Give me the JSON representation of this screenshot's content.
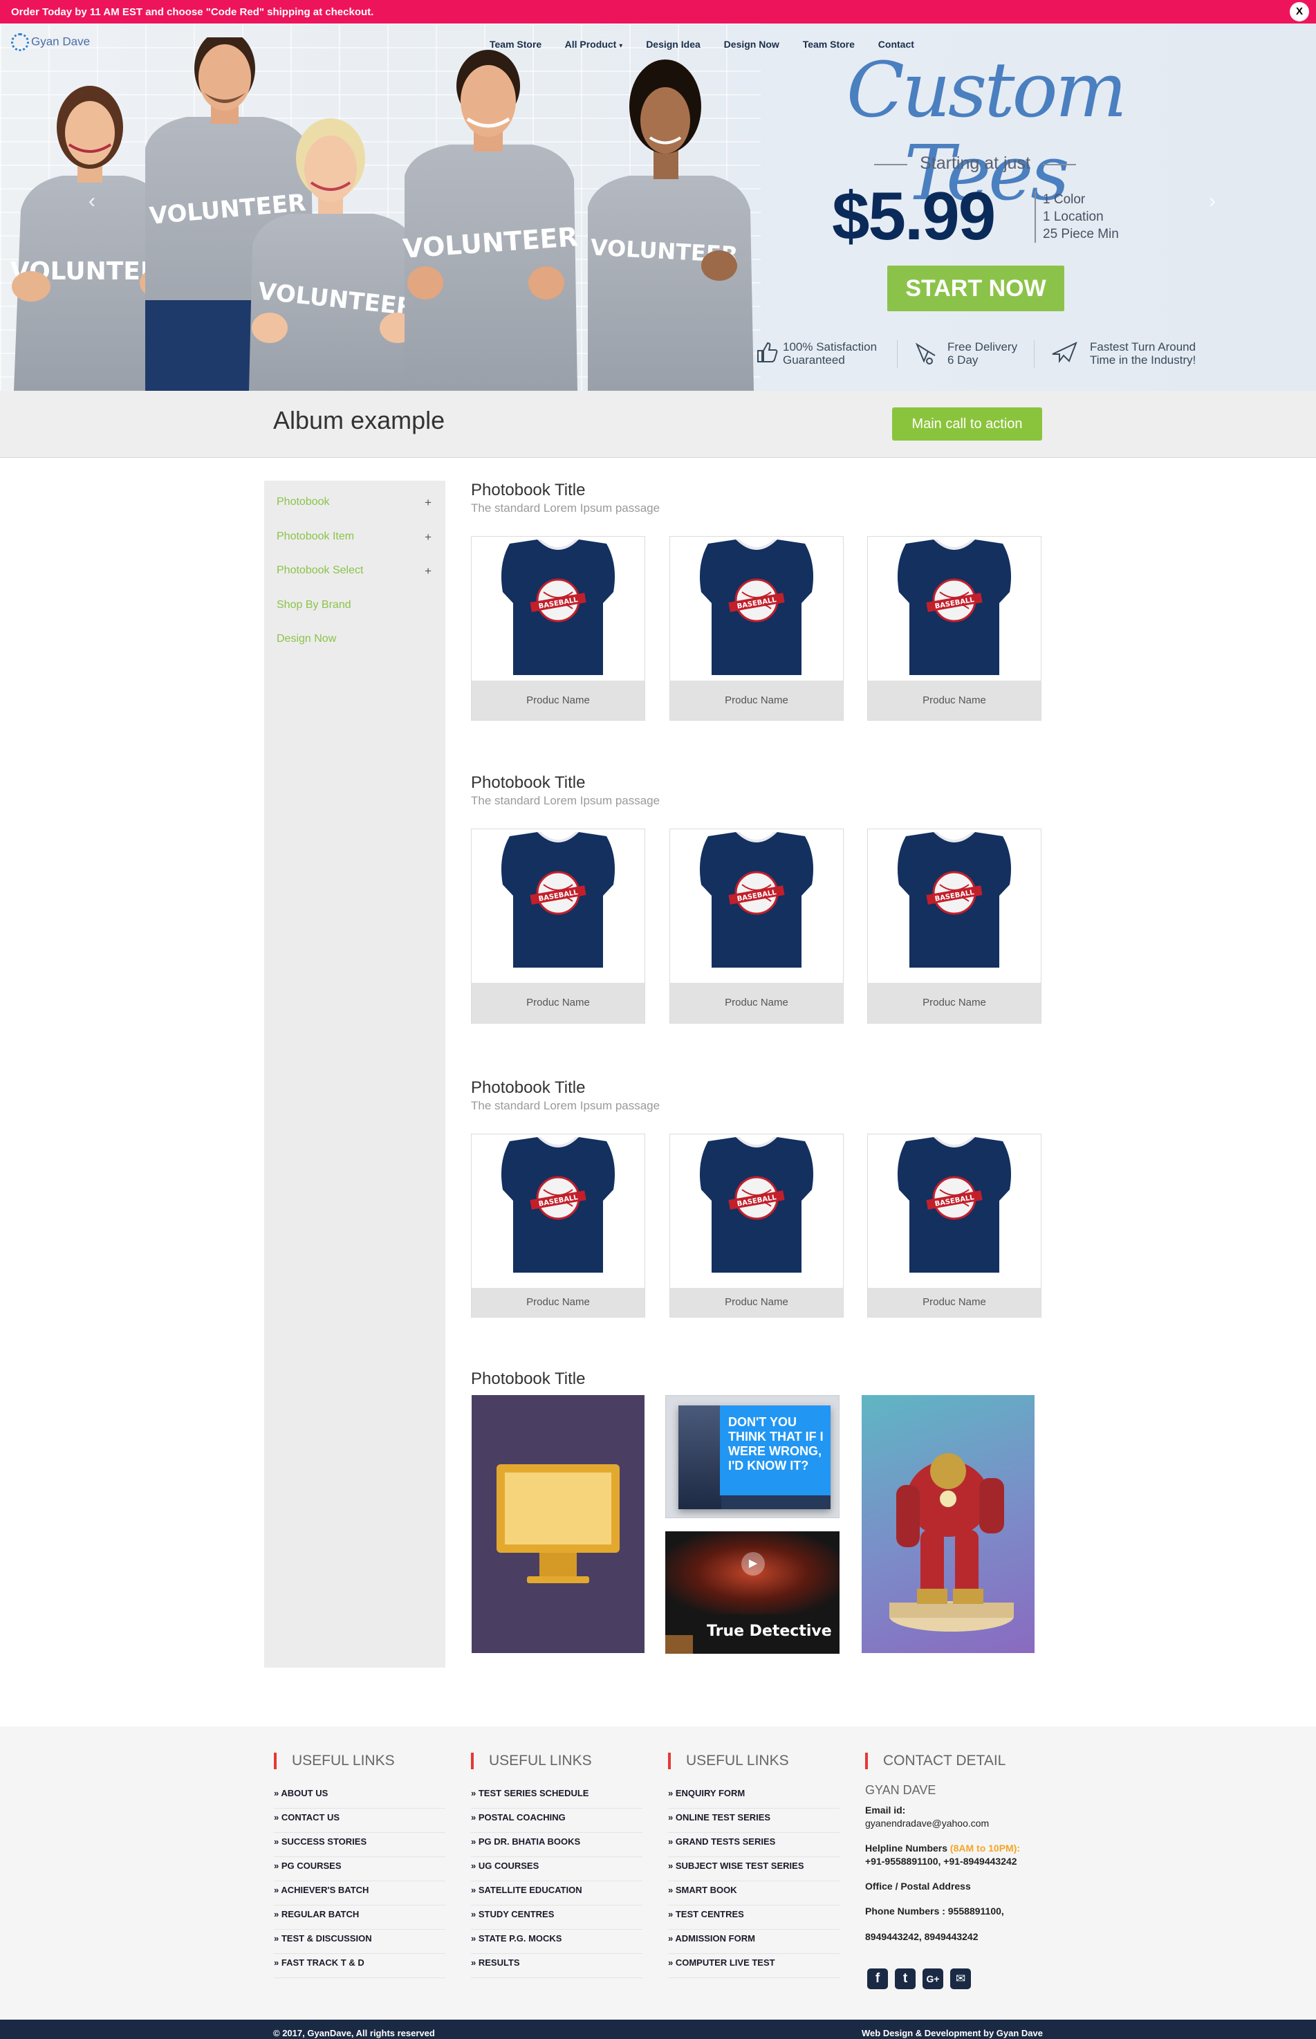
{
  "promo": {
    "message": "Order Today by 11 AM EST and choose \"Code Red\" shipping at checkout.",
    "close_label": "X"
  },
  "brand": {
    "name": "Gyan Dave"
  },
  "nav": {
    "items": [
      "Team Store",
      "All Product",
      "Design Idea",
      "Design Now",
      "Team Store",
      "Contact"
    ]
  },
  "hero": {
    "headline": "Custom Tees",
    "starting_at": "Starting at just",
    "price": "$5.99",
    "details": [
      "1 Color",
      "1  Location",
      "25 Piece Min"
    ],
    "cta": "START NOW",
    "shirt_text": "VOLUNTEER",
    "features": [
      {
        "line1": "100% Satisfaction",
        "line2": "Guaranteed",
        "icon": "thumbs-up-icon"
      },
      {
        "line1": "Free Delivery",
        "line2": "6 Day",
        "icon": "delivery-icon"
      },
      {
        "line1": "Fastest Turn Around",
        "line2": "Time in the Industry!",
        "icon": "plane-icon"
      }
    ]
  },
  "album": {
    "title": "Album example",
    "cta": "Main call to action"
  },
  "sidebar": {
    "items": [
      {
        "label": "Photobook",
        "plus": "+"
      },
      {
        "label": "Photobook Item",
        "plus": "+"
      },
      {
        "label": "Photobook Select",
        "plus": "+"
      },
      {
        "label": "Shop By Brand",
        "plus": ""
      },
      {
        "label": "Design Now",
        "plus": ""
      }
    ]
  },
  "sections": [
    {
      "title": "Photobook Title",
      "subtitle": "The standard Lorem Ipsum passage",
      "products": [
        "Produc Name",
        "Produc Name",
        "Produc Name"
      ]
    },
    {
      "title": "Photobook Title",
      "subtitle": "The standard Lorem Ipsum passage",
      "products": [
        "Produc Name",
        "Produc Name",
        "Produc Name"
      ]
    },
    {
      "title": "Photobook Title",
      "subtitle": "The standard Lorem Ipsum passage",
      "products": [
        "Produc Name",
        "Produc Name",
        "Produc Name"
      ]
    }
  ],
  "gallery": {
    "title": "Photobook Title",
    "quote": "DON'T YOU THINK THAT IF I WERE WRONG, I'D KNOW IT?",
    "show_title": "True Detective"
  },
  "jersey_text": "BASEBALL",
  "footer": {
    "columns": [
      {
        "heading": "USEFUL LINKS",
        "links": [
          "» ABOUT US",
          "» CONTACT US",
          "» SUCCESS STORIES",
          "» PG COURSES",
          "» ACHIEVER'S BATCH",
          "» REGULAR BATCH",
          "» TEST & DISCUSSION",
          "» FAST TRACK T & D"
        ]
      },
      {
        "heading": "USEFUL LINKS",
        "links": [
          "» TEST SERIES SCHEDULE",
          "» POSTAL COACHING",
          "» PG DR. BHATIA BOOKS",
          "» UG COURSES",
          "» SATELLITE EDUCATION",
          "» STUDY CENTRES",
          "» STATE P.G. MOCKS",
          "» RESULTS"
        ]
      },
      {
        "heading": "USEFUL LINKS",
        "links": [
          "» ENQUIRY FORM",
          "» ONLINE TEST SERIES",
          "» GRAND TESTS SERIES",
          "» SUBJECT WISE TEST SERIES",
          "» SMART BOOK",
          "» TEST CENTRES",
          "» ADMISSION FORM",
          "» COMPUTER LIVE TEST"
        ]
      }
    ],
    "contact": {
      "heading": "CONTACT DETAIL",
      "name": "GYAN DAVE",
      "email_label": "Email id:",
      "email": "gyanendradave@yahoo.com",
      "helpline_label": "Helpline Numbers",
      "helpline_hours": "(8AM to 10PM):",
      "helpline": "+91-9558891100, +91-8949443242",
      "office_label": "Office / Postal Address",
      "phone_label": "Phone Numbers :",
      "phone1": " 9558891100,",
      "phone2": "8949443242, 8949443242"
    },
    "social": [
      {
        "icon": "facebook-icon",
        "glyph": "f"
      },
      {
        "icon": "twitter-icon",
        "glyph": "t"
      },
      {
        "icon": "google-plus-icon",
        "glyph": "G+"
      },
      {
        "icon": "email-icon",
        "glyph": "✉"
      }
    ]
  },
  "bottom": {
    "copyright": "© 2017, GyanDave, All rights reserved",
    "credit": "Web Design & Development by Gyan Dave"
  },
  "colors": {
    "promo": "#ee145b",
    "accent_green": "#8bc34a",
    "navy": "#1a2a45",
    "price": "#0a2a5a",
    "headline": "#4a7fc0"
  }
}
